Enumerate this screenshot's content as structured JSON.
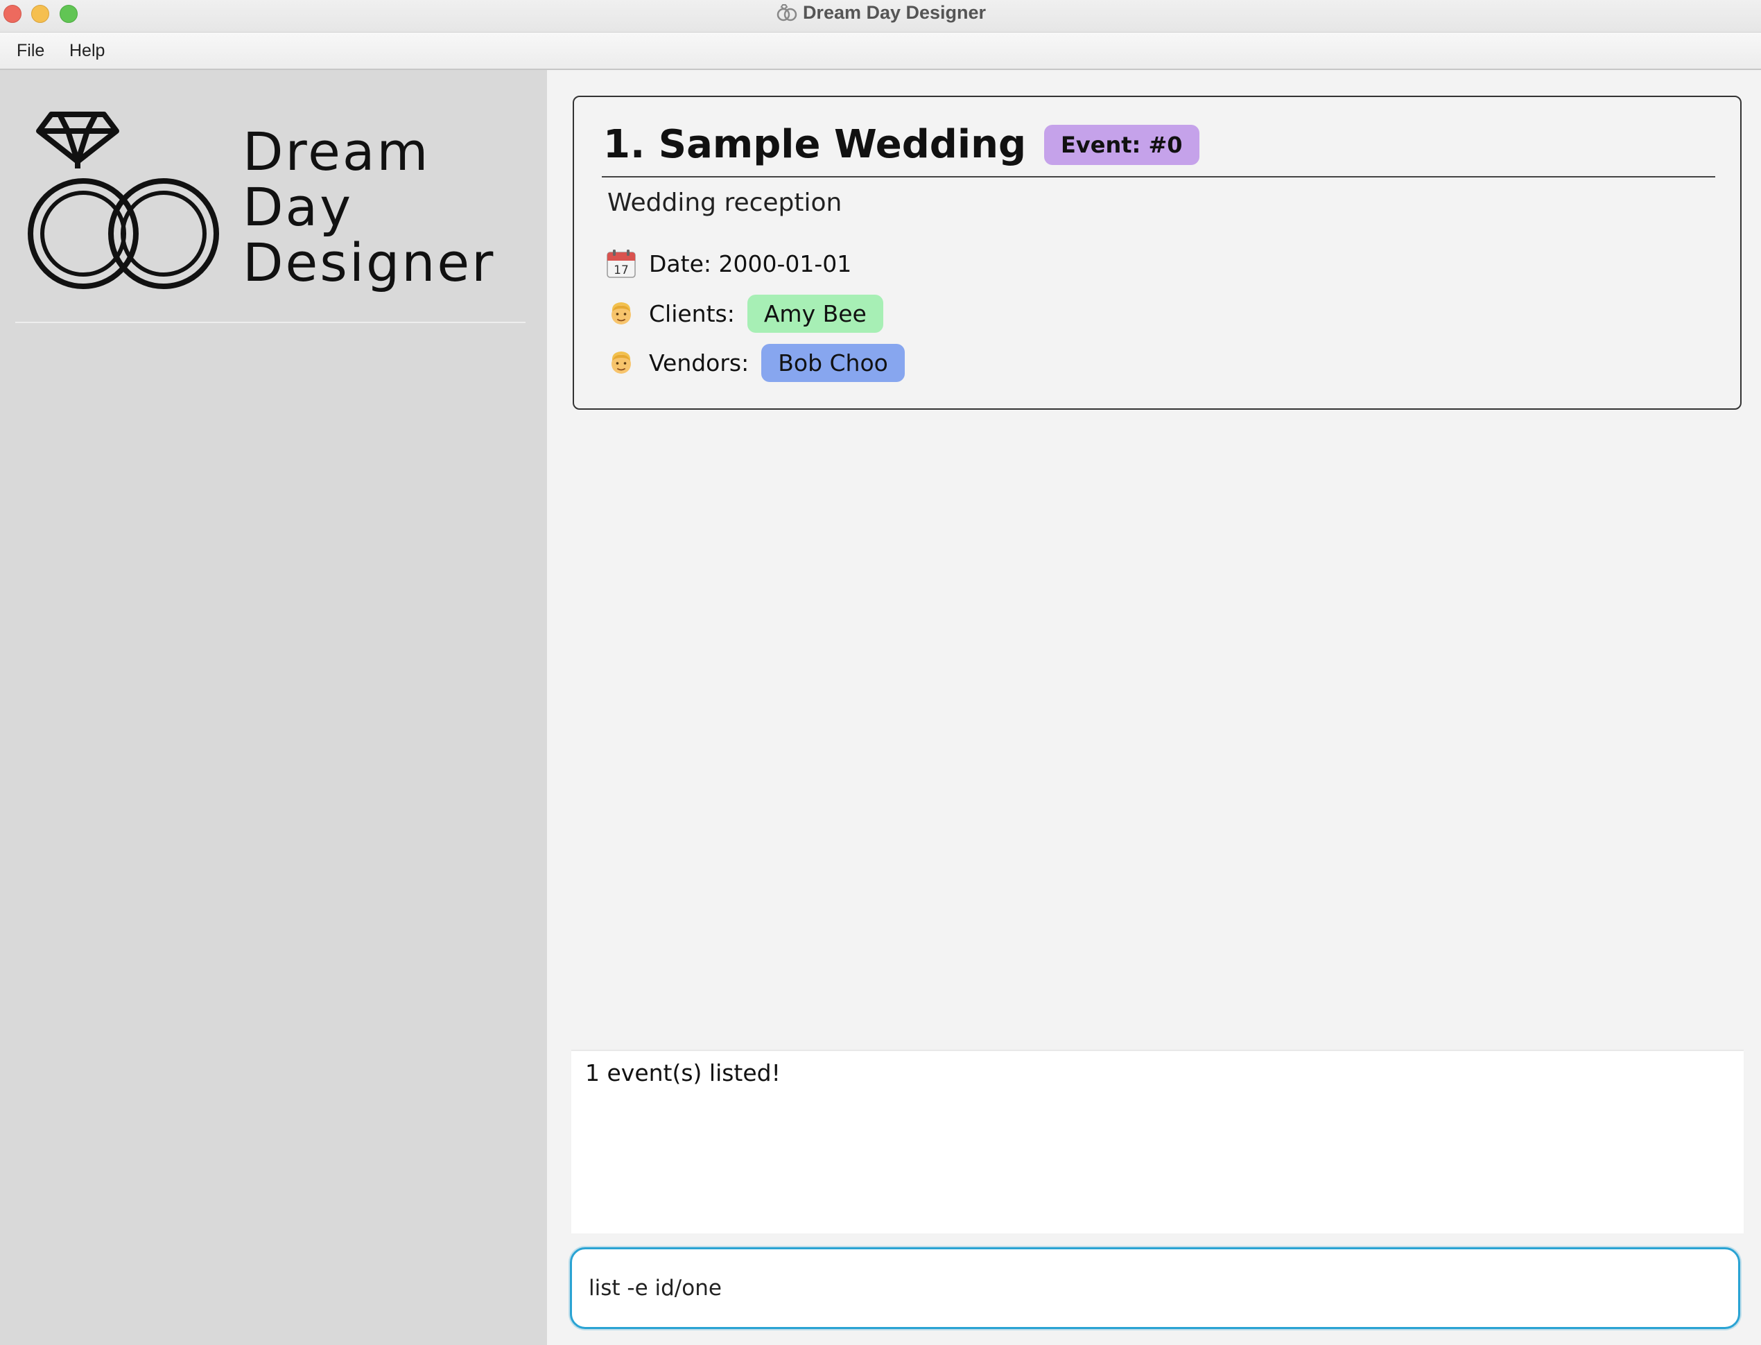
{
  "window": {
    "title": "Dream Day Designer",
    "controls": [
      "close",
      "minimize",
      "maximize"
    ]
  },
  "menu": {
    "items": [
      {
        "label": "File"
      },
      {
        "label": "Help"
      }
    ]
  },
  "sidebar": {
    "logo_lines": [
      "Dream",
      "Day",
      "Designer"
    ],
    "logo_icon": "wedding-rings-icon"
  },
  "event_list": {
    "events": [
      {
        "title": "1. Sample Wedding",
        "badge": "Event: #0",
        "description": "Wedding reception",
        "date_label": "Date: 2000-01-01",
        "date_icon": "calendar-icon",
        "clients_label": "Clients:",
        "clients": [
          "Amy Bee"
        ],
        "clients_icon": "person-icon",
        "vendors_label": "Vendors:",
        "vendors": [
          "Bob Choo"
        ],
        "vendors_icon": "person-icon"
      }
    ]
  },
  "result": {
    "message": "1 event(s) listed!"
  },
  "command": {
    "value": "list -e id/one"
  },
  "colors": {
    "badge": "#c5a2ea",
    "client_chip": "#a7efb5",
    "vendor_chip": "#87a6ef",
    "command_border": "#2aa3d3",
    "sidebar_bg": "#d9d9d9"
  }
}
